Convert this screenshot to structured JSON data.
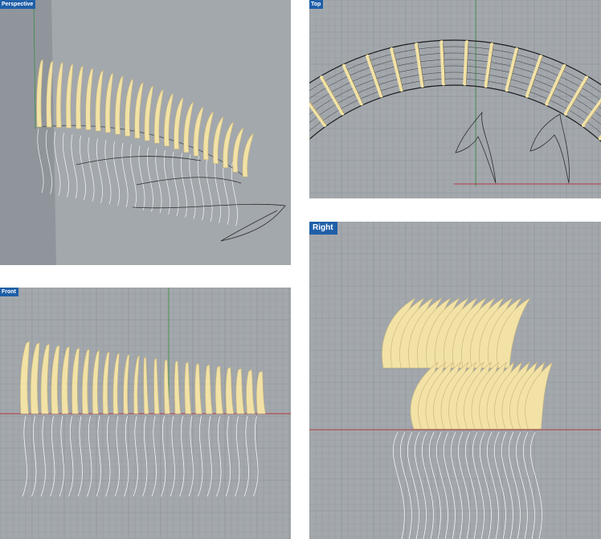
{
  "viewports": {
    "perspective": {
      "label": "Perspective"
    },
    "top": {
      "label": "Top"
    },
    "front": {
      "label": "Front"
    },
    "right": {
      "label": "Right"
    }
  },
  "colors": {
    "viewport_bg": "#a3a8ad",
    "grid_minor": "#989ca1",
    "grid_major": "#8b9095",
    "fin_fill": "#f2e2a6",
    "fin_shade": "#c7b57c",
    "curve_white": "#ffffff",
    "curve_dark": "#2e2e2e",
    "axis_x": "#b3393d",
    "axis_y": "#3f8d4a",
    "label_bg": "#1f5fa8"
  }
}
